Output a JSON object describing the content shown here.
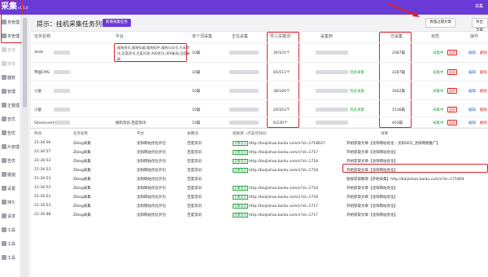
{
  "app": {
    "brand": "采集",
    "version": "v1.1.0",
    "top_right_label": "采集"
  },
  "sidebar": {
    "items": [
      {
        "label": "务管理",
        "dim": false
      },
      {
        "label": "务管理",
        "dim": false
      },
      {
        "label": "管理",
        "dim": true
      },
      {
        "label": "链接",
        "dim": true
      },
      {
        "label": "器管",
        "dim": false
      },
      {
        "label": "管理",
        "dim": false
      },
      {
        "label": "正整理",
        "dim": false
      },
      {
        "label": "告优",
        "dim": false
      },
      {
        "label": "告优",
        "dim": false
      },
      {
        "label": "片管理",
        "dim": false
      },
      {
        "label": "告优",
        "dim": false
      },
      {
        "label": "键遍",
        "dim": false
      },
      {
        "label": "设置",
        "dim": false
      },
      {
        "label": "持久",
        "dim": false
      },
      {
        "label": "请求",
        "dim": false
      },
      {
        "label": "工具",
        "dim": false
      },
      {
        "label": "工具",
        "dim": false
      },
      {
        "label": "工具",
        "dim": false
      }
    ]
  },
  "header": {
    "prompt": "提示：挂机采集任务列表",
    "new_task": "新增采集任务",
    "btn_clear": "清理过期文章",
    "btn_export": "导出全部"
  },
  "task_table": {
    "columns": [
      "任务名称",
      "平台",
      "单个词采集",
      "正在采集",
      "导入关键词",
      "采集到",
      "已采集",
      "状态",
      "操作"
    ],
    "keywords_lines": [
      "搜狗资讯,搜狗知道,搜狗知乎,搜狗公众号,头条资",
      "讯,百度资讯,百度问答,360资讯,360新闻,百度新",
      "闻"
    ],
    "rows": [
      {
        "name": "dede",
        "single": "10篇",
        "imported": "30/101个",
        "collected": "",
        "done": "2087篇",
        "state": "采集中",
        "tag": "暂停",
        "edit": "编辑",
        "del": "删除"
      },
      {
        "name": "帝国CMS",
        "single": "10篇",
        "imported": "65/511个",
        "collected": "到此采集",
        "done": "2287篇",
        "state": "采集中",
        "tag": "暂停",
        "edit": "编辑",
        "del": "删除"
      },
      {
        "name": "小旋",
        "single": "10篇",
        "imported": "38/160个",
        "collected": "到此采集",
        "done": "1842篇",
        "state": "采集中",
        "tag": "暂停",
        "edit": "编辑",
        "del": "删除"
      },
      {
        "name": "小旋",
        "single": "10篇",
        "imported": "20/163个",
        "collected": "到此采集",
        "done": "1536篇",
        "state": "采集中",
        "tag": "暂停",
        "edit": "编辑",
        "del": "删除"
      },
      {
        "name": "SiteserverCMS采集",
        "single": "10篇",
        "imported": "6/230个",
        "collected": "",
        "done": "403篇",
        "state": "采集中",
        "tag": "暂停",
        "edit": "编辑",
        "del": "删除"
      }
    ],
    "last_row_kw": "搜狗资讯,百度资讯"
  },
  "log": {
    "columns": [
      "时间",
      "任务名称",
      "平台",
      "关键词",
      "平台",
      "链接源（点击可访问）",
      "详情"
    ],
    "rows": [
      {
        "time": "21:34:56",
        "task": "Zblog采集",
        "kw": "沈阳网站优化外包",
        "plat": "百度资讯",
        "ok": "采集成功",
        "url": "http://baijiahao.baidu.com/s?id=1718637",
        "detail": "开始获取文章【沈阳网站优化：沈阳SEO_沈阳网络推广】"
      },
      {
        "time": "21:34:57",
        "task": "Zblog采集",
        "kw": "沈阳网站优化外包",
        "plat": "百度资讯",
        "ok": "采集成功",
        "url": "http://baijiahao.baidu.com/s?id=1717",
        "detail": "开始获取文章【沈阳网站优化】"
      },
      {
        "time": "21:34:53",
        "task": "Zblog采集",
        "kw": "沈阳网站优化外包",
        "plat": "百度资讯",
        "ok": "采集成功",
        "url": "http://baijiahao.baidu.com/s?id=1718",
        "detail": "开始获取文章【沈阳网站优化】"
      },
      {
        "time": "21:34:53",
        "task": "Zblog采集",
        "kw": "沈阳网站优化外包",
        "plat": "百度资讯",
        "ok": "采集成功",
        "url": "http://baijiahao.baidu.com/s?id=1718",
        "detail": "开始获取文章【沈阳网站优化】"
      },
      {
        "time": "21:34:53",
        "task": "Zblog采集",
        "kw": "沈阳网站优化外包",
        "plat": "百度资讯",
        "ok": "",
        "url": "",
        "detail": "链接获取数目【开始采集】http://baijiahao.baidu.com/s?id=171804"
      },
      {
        "time": "21:34:53",
        "task": "Zblog采集",
        "kw": "沈阳网站优化外包",
        "plat": "百度资讯",
        "ok": "采集成功",
        "url": "http://baijiahao.baidu.com/s?id=1718",
        "detail": "开始获取文章【沈阳网站优化】"
      },
      {
        "time": "21:34:53",
        "task": "Zblog采集",
        "kw": "沈阳网站优化外包",
        "plat": "百度资讯",
        "ok": "采集成功",
        "url": "http://baijiahao.baidu.com/s?id=1718",
        "detail": "开始获取文章【沈阳网站优化】"
      },
      {
        "time": "21:34:53",
        "task": "Zblog采集",
        "kw": "沈阳网站优化外包",
        "plat": "百度资讯",
        "ok": "采集成功",
        "url": "http://baijiahao.baidu.com/s?id=1717",
        "detail": "开始获取文章【沈阳网站优化】"
      },
      {
        "time": "21:34:48",
        "task": "Zblog采集",
        "kw": "沈阳网站优化外包",
        "plat": "百度资讯",
        "ok": "采集成功",
        "url": "http://baijiahao.baidu.com/s?id=1717",
        "detail": "开始获取文章【沈阳网站优化】"
      }
    ]
  },
  "colors": {
    "accent": "#6a3bd6",
    "highlight": "#e0202a",
    "ok": "#2ea84a",
    "danger": "#d9302c"
  }
}
